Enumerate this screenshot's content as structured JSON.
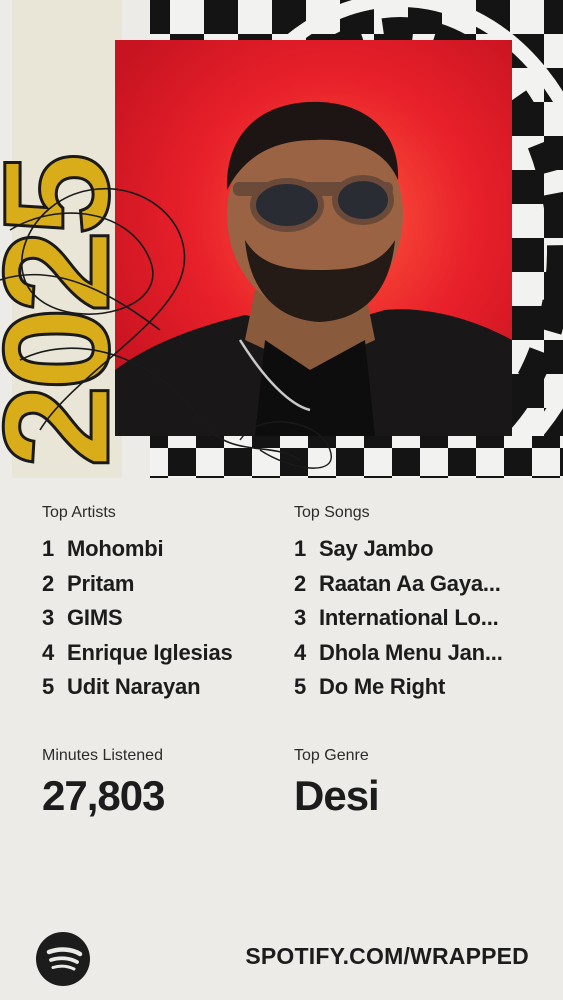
{
  "hero": {
    "year_art": "2025",
    "cover_image": "artist portrait photo"
  },
  "top_artists": {
    "label": "Top Artists",
    "items": [
      {
        "rank": "1",
        "name": "Mohombi"
      },
      {
        "rank": "2",
        "name": "Pritam"
      },
      {
        "rank": "3",
        "name": "GIMS"
      },
      {
        "rank": "4",
        "name": "Enrique Iglesias"
      },
      {
        "rank": "5",
        "name": "Udit Narayan"
      }
    ]
  },
  "top_songs": {
    "label": "Top Songs",
    "items": [
      {
        "rank": "1",
        "name": "Say Jambo"
      },
      {
        "rank": "2",
        "name": "Raatan Aa Gaya..."
      },
      {
        "rank": "3",
        "name": "International Lo..."
      },
      {
        "rank": "4",
        "name": "Dhola Menu Jan..."
      },
      {
        "rank": "5",
        "name": "Do Me Right"
      }
    ]
  },
  "minutes": {
    "label": "Minutes Listened",
    "value": "27,803"
  },
  "genre": {
    "label": "Top Genre",
    "value": "Desi"
  },
  "footer": {
    "url": "SPOTIFY.COM/WRAPPED",
    "logo_icon": "spotify-logo-icon"
  },
  "colors": {
    "background": "#ecebe7",
    "accent_yellow": "#d9ad19",
    "cover_red": "#e8202a",
    "checker_dark": "#141414"
  }
}
